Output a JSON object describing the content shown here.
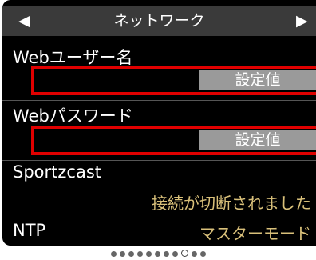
{
  "header": {
    "title": "ネットワーク",
    "prev_icon": "◀",
    "next_icon": "▶"
  },
  "rows": {
    "web_user": {
      "label": "Webユーザー名",
      "value": "設定値"
    },
    "web_password": {
      "label": "Webパスワード",
      "value": "設定値"
    },
    "sportzcast": {
      "label": "Sportzcast",
      "status": "接続が切断されました"
    },
    "ntp": {
      "label": "NTP",
      "value": "マスターモード"
    }
  },
  "pagination": {
    "total_pages": 11,
    "current_page": 9
  },
  "colors": {
    "highlight_border": "#e00000",
    "status_text": "#d9c07a",
    "value_box": "#9a9a9a",
    "header_bg": "#3a3a3a"
  }
}
